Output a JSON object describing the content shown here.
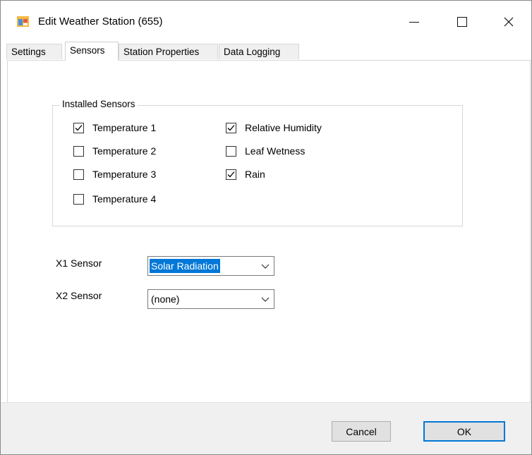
{
  "window": {
    "title": "Edit Weather Station (655)",
    "icon": "app-window-icon",
    "controls": {
      "minimize": "minimize-icon",
      "maximize": "maximize-icon",
      "close": "close-icon"
    }
  },
  "tabs": [
    {
      "label": "Settings",
      "active": false
    },
    {
      "label": "Sensors",
      "active": true
    },
    {
      "label": "Station Properties",
      "active": false
    },
    {
      "label": "Data Logging",
      "active": false
    }
  ],
  "installed_sensors": {
    "title": "Installed Sensors",
    "items": [
      {
        "label": "Temperature 1",
        "checked": true
      },
      {
        "label": "Temperature 2",
        "checked": false
      },
      {
        "label": "Temperature 3",
        "checked": false
      },
      {
        "label": "Temperature 4",
        "checked": false
      },
      {
        "label": "Relative Humidity",
        "checked": true
      },
      {
        "label": "Leaf Wetness",
        "checked": false
      },
      {
        "label": "Rain",
        "checked": true
      }
    ]
  },
  "x1": {
    "label": "X1 Sensor",
    "value": "Solar Radiation"
  },
  "x2": {
    "label": "X2 Sensor",
    "value": "(none)"
  },
  "buttons": {
    "cancel": "Cancel",
    "ok": "OK"
  },
  "colors": {
    "accent": "#0078d7",
    "footer_bg": "#f0f0f0",
    "button_bg": "#e1e1e1"
  }
}
